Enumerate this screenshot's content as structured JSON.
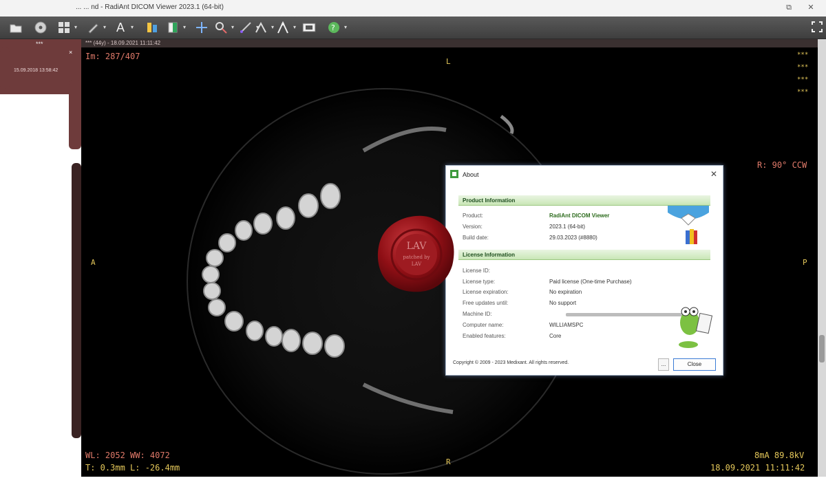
{
  "window": {
    "title": "... ... nd - RadiAnt DICOM Viewer 2023.1 (64-bit)",
    "restore_glyph": "⧉",
    "close_glyph": "✕"
  },
  "toolbar": {
    "items": [
      {
        "name": "open-icon"
      },
      {
        "name": "cd-icon"
      },
      {
        "name": "layout-icon"
      },
      {
        "name": "pen-icon"
      },
      {
        "name": "text-icon",
        "label": "A"
      },
      {
        "name": "window-level-icon"
      },
      {
        "name": "pan-icon"
      },
      {
        "name": "zoom-icon"
      },
      {
        "name": "measure-icon"
      },
      {
        "name": "angle-icon"
      },
      {
        "name": "3d-icon"
      },
      {
        "name": "video-icon"
      },
      {
        "name": "help-icon"
      }
    ],
    "fullscreen_icon": "fullscreen-icon"
  },
  "left_panel": {
    "stars": "***",
    "close_label": "×",
    "date": "15.09.2018 13:58:42"
  },
  "viewer": {
    "header": "*** (44y) - 18.09.2021 11:11:42",
    "image_index": "Im: 287/407",
    "orient_top": "L",
    "orient_left": "A",
    "orient_right": "P",
    "orient_bottom": "R",
    "rotation": "R: 90° CCW",
    "top_right_lines": [
      "***",
      "***",
      "***",
      "***"
    ],
    "wl_ww": "WL: 2052 WW: 4072",
    "thickness_location": "T: 0.3mm L: -26.4mm",
    "exposure": "8mA 89.8kV",
    "acq_datetime": "18.09.2021 11:11:42",
    "colors": {
      "overlay_red": "#e07a6a",
      "overlay_yellow": "#e5c85a"
    }
  },
  "about": {
    "title": "About",
    "close_glyph": "✕",
    "product_section": "Product Information",
    "product_rows": [
      {
        "key": "Product:",
        "value": "RadiAnt DICOM Viewer"
      },
      {
        "key": "Version:",
        "value": "2023.1 (64-bit)"
      },
      {
        "key": "Build date:",
        "value": "29.03.2023 (#8880)"
      }
    ],
    "license_section": "License Information",
    "license_rows": [
      {
        "key": "License ID:",
        "value": ""
      },
      {
        "key": "License type:",
        "value": "Paid license (One-time Purchase)"
      },
      {
        "key": "License expiration:",
        "value": "No expiration"
      },
      {
        "key": "Free updates until:",
        "value": "No support"
      },
      {
        "key": "Machine ID:",
        "value": ""
      },
      {
        "key": "Computer name:",
        "value": "WILLIAMSPC"
      },
      {
        "key": "Enabled features:",
        "value": "Core"
      }
    ],
    "copyright": "Copyright © 2009 - 2023 Medixant. All rights reserved.",
    "ellipsis_button": "...",
    "close_button": "Close",
    "accent": "#2c6b1c"
  },
  "seal": {
    "text_line1": "LAV",
    "text_line2": "patched by",
    "text_line3": "LAV"
  }
}
